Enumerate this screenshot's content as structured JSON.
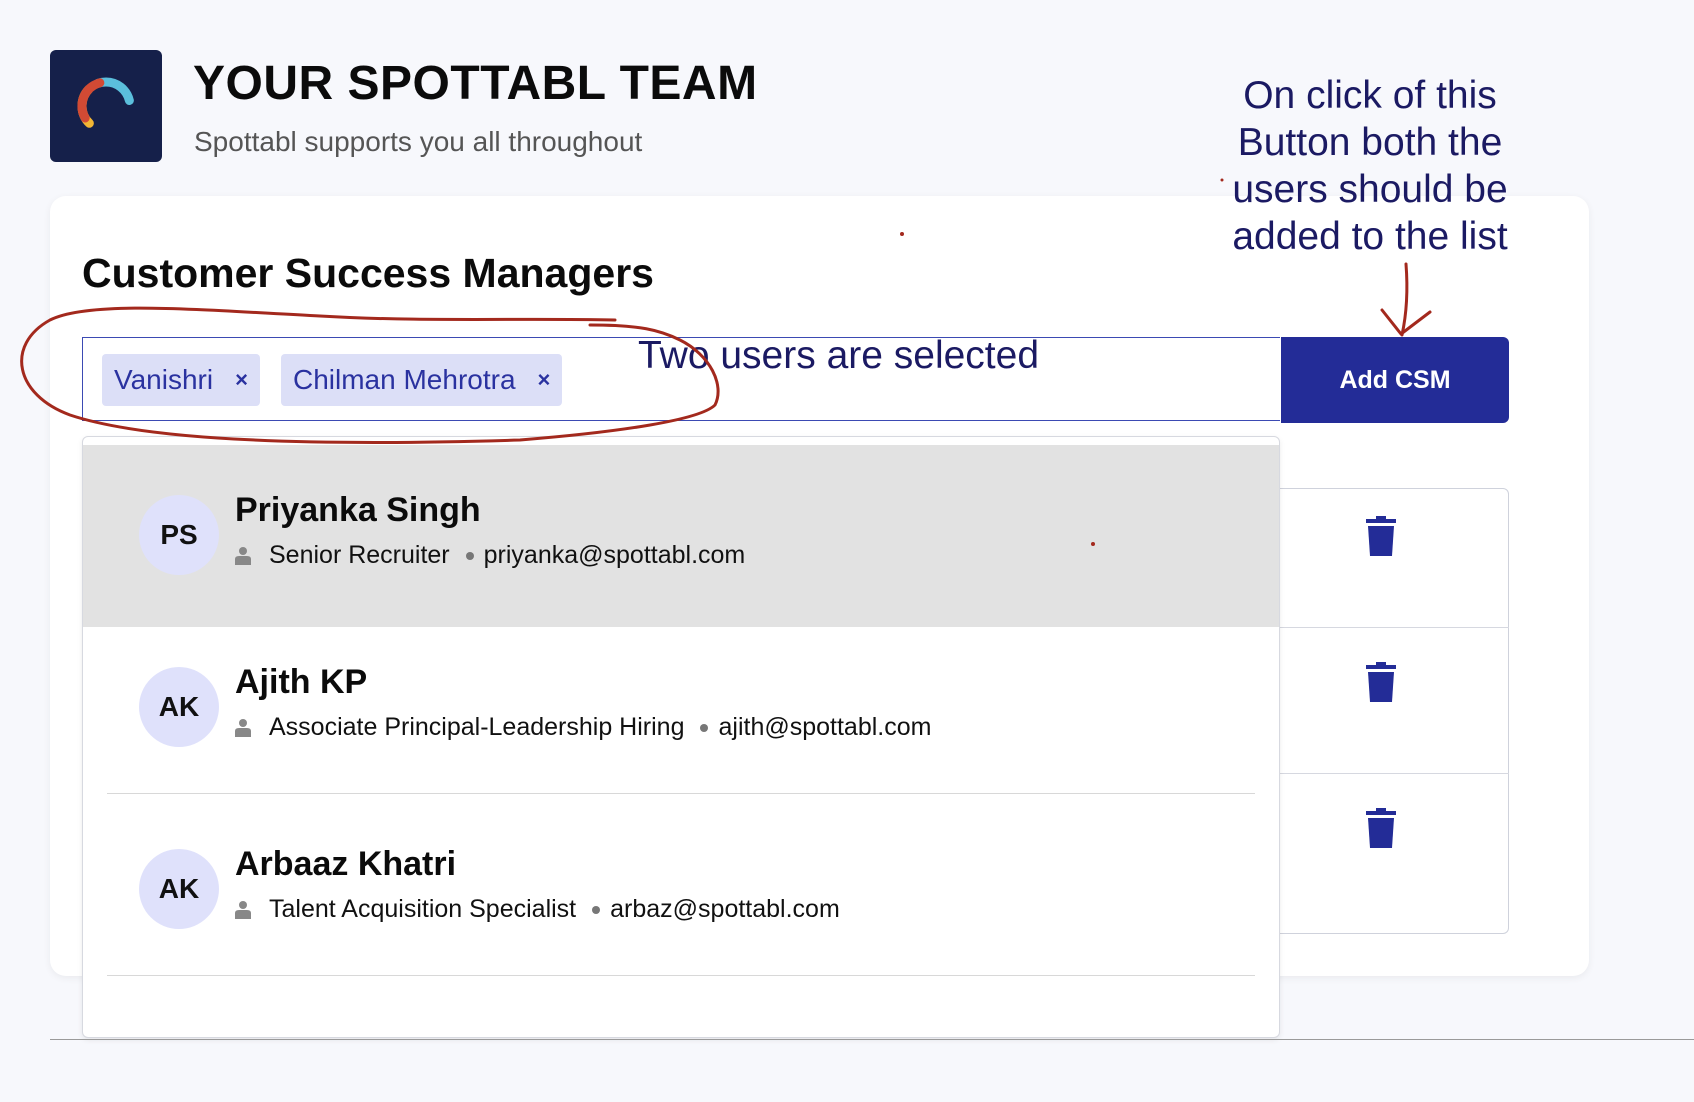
{
  "header": {
    "title": "YOUR SPOTTABL TEAM",
    "subtitle": "Spottabl supports you all throughout",
    "logo_icon": "spottabl-ring-logo"
  },
  "section": {
    "title": "Customer Success Managers"
  },
  "selector": {
    "selected_chips": [
      {
        "label": "Vanishri",
        "remove": "×"
      },
      {
        "label": "Chilman Mehrotra",
        "remove": "×"
      }
    ],
    "add_button": "Add CSM"
  },
  "dropdown": {
    "options": [
      {
        "initials": "PS",
        "name": "Priyanka Singh",
        "role": "Senior Recruiter",
        "email": "priyanka@spottabl.com",
        "highlighted": true
      },
      {
        "initials": "AK",
        "name": "Ajith KP",
        "role": "Associate Principal-Leadership Hiring",
        "email": "ajith@spottabl.com",
        "highlighted": false
      },
      {
        "initials": "AK",
        "name": "Arbaaz Khatri",
        "role": "Talent Acquisition Specialist",
        "email": "arbaz@spottabl.com",
        "highlighted": false
      }
    ]
  },
  "annotations": {
    "button_note_lines": [
      "On click of this",
      "Button both the",
      "users should be",
      "added to the list"
    ],
    "selection_note": "Two users are selected"
  },
  "colors": {
    "primary": "#232c97",
    "chip_bg": "#dcdff7",
    "annotation_ink": "#a3291d",
    "annotation_text": "#1b1a63"
  }
}
